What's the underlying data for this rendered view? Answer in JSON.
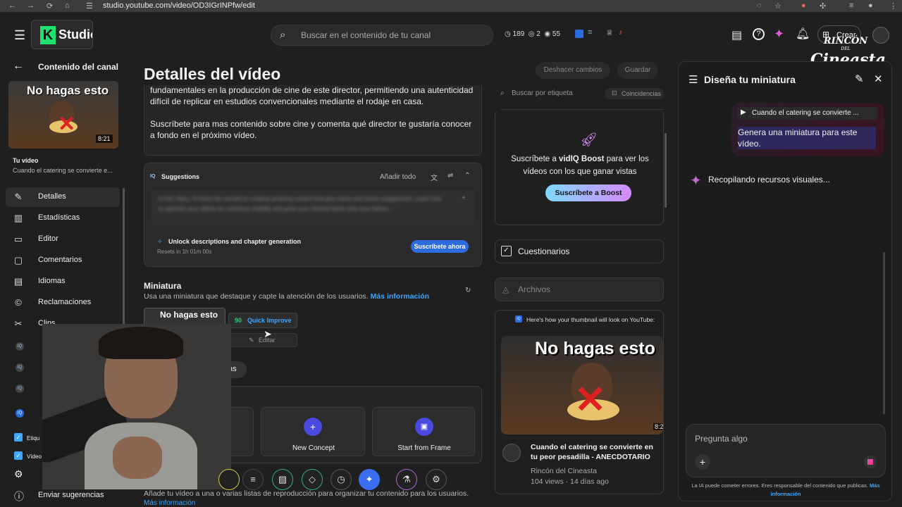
{
  "browser": {
    "url": "studio.youtube.com/video/OD3IGrINPfw/edit"
  },
  "header": {
    "logo_text": "Studio",
    "search_placeholder": "Buscar en el contenido de tu canal",
    "stats": {
      "a": "189",
      "b": "2",
      "c": "55"
    },
    "create_label": "Crear",
    "watermark_line1": "RINCÓN",
    "watermark_line2": "DEL",
    "watermark_line3": "Cineasta"
  },
  "sidebar": {
    "back_label": "Contenido del canal",
    "thumb_text": "No hagas esto",
    "thumb_duration": "8:21",
    "your_video_label": "Tu vídeo",
    "video_title_short": "Cuando el catering se convierte e...",
    "items": [
      {
        "label": "Detalles",
        "icon": "pencil-icon"
      },
      {
        "label": "Estadísticas",
        "icon": "chart-icon"
      },
      {
        "label": "Editor",
        "icon": "film-icon"
      },
      {
        "label": "Comentarios",
        "icon": "comment-icon"
      },
      {
        "label": "Idiomas",
        "icon": "subtitles-icon"
      },
      {
        "label": "Reclamaciones",
        "icon": "copyright-icon"
      },
      {
        "label": "Clips",
        "icon": "scissors-icon"
      }
    ],
    "bottom_items": [
      {
        "label": "Etiqu"
      },
      {
        "label": "Vídeo"
      }
    ],
    "feedback_label": "Enviar sugerencias"
  },
  "main": {
    "title": "Detalles del vídeo",
    "undo_label": "Deshacer cambios",
    "save_label": "Guardar",
    "description_line1": "fundamentales en la producción de cine de este director, permitiendo una autenticidad",
    "description_line2": "difícil de replicar en estudios convencionales mediante el rodaje en casa.",
    "description_line3": "Suscríbete para mas contenido sobre cine y comenta qué director te gustaría conocer",
    "description_line4": "a fondo en el próximo vídeo.",
    "suggestions": {
      "title": "Suggestions",
      "add_all": "Añadir todo",
      "blurred_text": "In this video, I'll share the secrets to creating amazing content that gets views and drives engagement. Learn how to optimize your videos for maximum visibility and grow your channel faster than ever before...",
      "unlock_text": "Unlock descriptions and chapter generation",
      "reset_text": "Resets in 1h 01m 00s",
      "subscribe_btn": "Suscríbete ahora"
    },
    "thumbnail": {
      "heading": "Miniatura",
      "desc": "Usa una miniatura que destaque y capte la atención de los usuarios.",
      "more_info": "Más información",
      "thumb_text": "No hagas esto",
      "score": "90",
      "quick_improve": "Quick Improve",
      "edit": "Editar"
    },
    "partial_chip": "as",
    "concepts": {
      "new_concept": "New Concept",
      "start_from_frame": "Start from Frame"
    },
    "playlist_text": "Añade tu vídeo a una o varias listas de reproducción para organizar tu contenido para los usuarios.",
    "playlist_more": "Más información"
  },
  "rightcol": {
    "tag_search": "Buscar por etiqueta",
    "coincidence": "Coincidencias",
    "boost_text1": "Suscríbete a",
    "boost_brand": "vidIQ Boost",
    "boost_text2": "para ver los",
    "boost_text3": "vídeos con los que ganar vistas",
    "boost_btn": "Suscríbete a Boost",
    "quizzes": "Cuestionarios",
    "files": "Archivos",
    "preview_label": "Here's how your thumbnail will look on YouTube:",
    "preview_thumb_text": "No hagas esto",
    "preview_duration": "8:2",
    "preview_title": "Cuando el catering se convierte en tu peor pesadilla - ANECDOTARIO",
    "preview_channel": "Rincón del Cineasta",
    "preview_meta": "104 views · 14 días ago"
  },
  "aipanel": {
    "title": "Diseña tu miniatura",
    "video_chip": "Cuando el catering se convierte ...",
    "user_msg": "Genera una miniatura para este vídeo.",
    "status": "Recopilando recursos visuales...",
    "input_placeholder": "Pregunta algo",
    "disclaimer": "La IA puede cometer errores. Eres responsable del contenido que publicas.",
    "disclaimer_link": "Más información"
  },
  "colors": {
    "accent_blue": "#3ea6ff",
    "gemini_pink": "#e05bd0",
    "boost_gradient_start": "#7fd8ff",
    "boost_gradient_end": "#d58bff",
    "vidiq_blue": "#2d6cdf"
  }
}
